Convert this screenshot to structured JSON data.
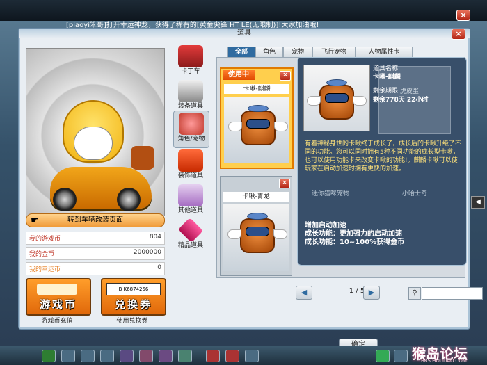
{
  "marquee": "[piaoyi笨哥]打开幸运神龙，获得了稀有的[黄金尖锋 HT LE(无限制)]!大家加油哦!",
  "window": {
    "title": "道具"
  },
  "left": {
    "modify_button": "转到车辆改装页面",
    "money": [
      {
        "label": "我的游戏币",
        "value": "804"
      },
      {
        "label": "我的金币",
        "value": "2000000"
      },
      {
        "label": "我的幸运币",
        "value": "0"
      }
    ],
    "game_coin_button": "游戏币",
    "game_coin_caption": "游戏币充值",
    "voucher_button": "兑换券",
    "voucher_code": "B K6874256",
    "voucher_caption": "使用兑换券"
  },
  "categories": [
    {
      "label": "卡丁车"
    },
    {
      "label": "装备道具"
    },
    {
      "label": "角色/宠物"
    },
    {
      "label": "装饰道具"
    },
    {
      "label": "其他道具"
    },
    {
      "label": "精品道具"
    }
  ],
  "tabs": [
    "全部",
    "角色",
    "宠物",
    "飞行宠物",
    "人物属性卡"
  ],
  "items": [
    {
      "name": "卡啾-麒麟",
      "badge": "使用中"
    },
    {
      "name": "卡啾-青龙"
    }
  ],
  "hidden_items": [
    "迷你猫咪宠物",
    "小哈士奇",
    "虎皮蛋"
  ],
  "pager": {
    "text": "1 / 5"
  },
  "confirm_button": "确定",
  "tooltip": {
    "name_label": "道具名称",
    "name": "卡啾-麒麟",
    "remain_label": "剩余期限",
    "remain": "剩余778天 22小时",
    "description": "有着神秘身世的卡啾终于成长了，成长后的卡啾升级了不同的功能。您可以同时拥有5种不同功能的成长型卡啾，也可以使用功能卡来改变卡啾的功能!。麒麟卡啾可以使玩家在启动加速时拥有更快的加速。",
    "effect_title": "增加启动加速",
    "effect_1": "成长功能：更加强力的启动加速",
    "effect_2": "成长功能：10~100%获得金币"
  },
  "watermark": "猴岛论坛",
  "watermark_sub": "BBS.HOUDAO.COM",
  "colors": {
    "accent": "#2f6ba0",
    "orange": "#f09b3a",
    "using": "#ffcf4d"
  }
}
